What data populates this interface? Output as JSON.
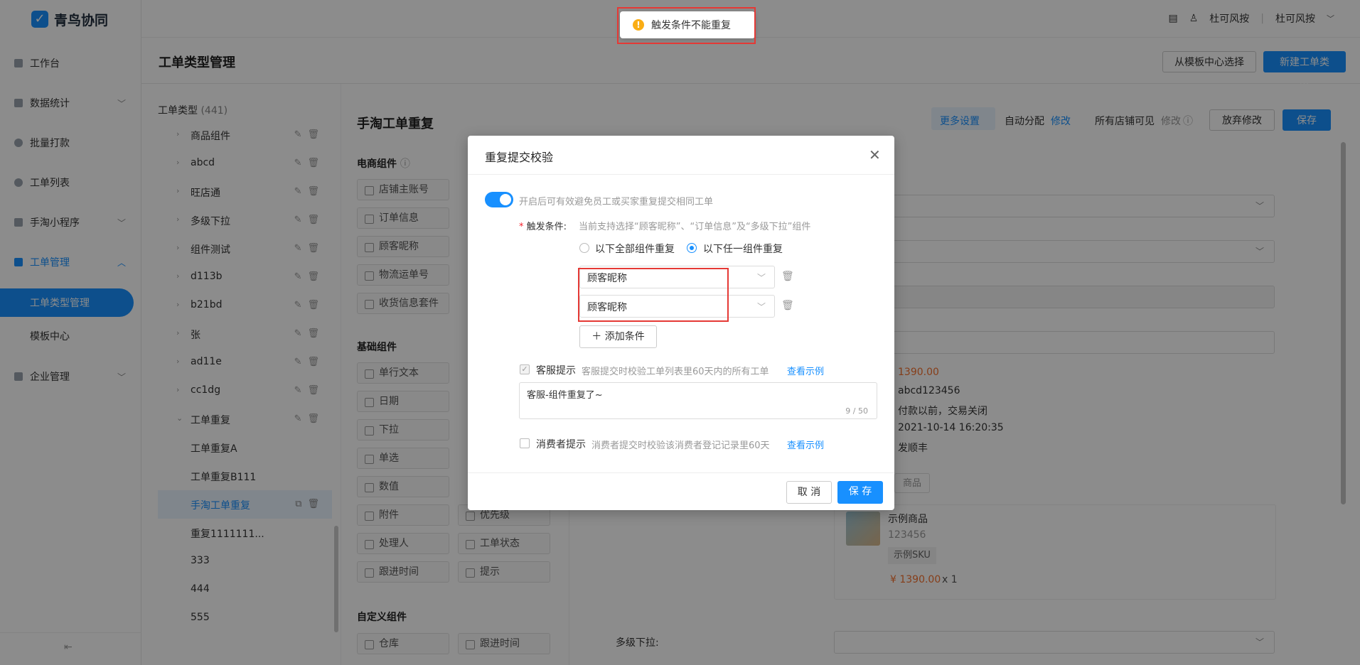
{
  "brand": "青鸟协同",
  "header": {
    "user_left": "杜可风按",
    "user_right": "杜可风按"
  },
  "sidebar": {
    "items": [
      {
        "label": "工作台",
        "expandable": false
      },
      {
        "label": "数据统计",
        "expandable": true
      },
      {
        "label": "批量打款",
        "expandable": false
      },
      {
        "label": "工单列表",
        "expandable": false
      },
      {
        "label": "手淘小程序",
        "expandable": true
      },
      {
        "label": "工单管理",
        "expandable": true,
        "open": true
      },
      {
        "label": "企业管理",
        "expandable": true
      }
    ],
    "subitems": [
      "工单类型管理",
      "模板中心"
    ]
  },
  "page": {
    "title": "工单类型管理",
    "btn_template": "从模板中心选择",
    "btn_new": "新建工单类型"
  },
  "tree": {
    "head": "工单类型",
    "count": "(441)",
    "rows": [
      "商品组件",
      "abcd",
      "旺店通",
      "多级下拉",
      "组件测试",
      "d113b",
      "b21bd",
      "张",
      "ad11e",
      "cc1dg",
      "工单重复"
    ],
    "children": [
      "工单重复A",
      "工单重复B111",
      "手淘工单重复",
      "重复1111111...",
      "333",
      "444",
      "555"
    ],
    "selected": "手淘工单重复"
  },
  "editor": {
    "title": "手淘工单重复",
    "more_settings": "更多设置",
    "auto_assign": "自动分配",
    "modify": "修改",
    "all_visible": "所有店铺可见",
    "modify2": "修改",
    "discard": "放弃修改",
    "save": "保存",
    "section_ecom": "电商组件",
    "ecom": [
      "店铺主账号",
      "订单信息",
      "顾客昵称",
      "物流运单号",
      "收货信息套件"
    ],
    "section_basic": "基础组件",
    "basic_left": [
      "单行文本",
      "日期",
      "下拉",
      "单选",
      "数值",
      "附件",
      "处理人",
      "跟进时间"
    ],
    "basic_right": [
      "优先级",
      "工单状态",
      "提示"
    ],
    "section_custom": "自定义组件",
    "custom": [
      "仓库",
      "跟进时间"
    ],
    "info": {
      "price": "1390.00",
      "order_no": "abcd123456",
      "status": "付款以前，交易关闭",
      "time": "2021-10-14 16:20:35",
      "logistics": "发顺丰"
    },
    "product": {
      "tag": "商品",
      "name": "示例商品",
      "id": "123456",
      "sku": "示例SKU",
      "price": "¥ 1390.00",
      "qty": "x 1"
    },
    "multi_dropdown": "多级下拉:"
  },
  "toast": {
    "text": "触发条件不能重复"
  },
  "dialog": {
    "title": "重复提交校验",
    "toggle_desc": "开启后可有效避免员工或买家重复提交相同工单",
    "trigger_label": "触发条件:",
    "trigger_hint": "当前支持选择“顾客昵称”、“订单信息”及“多级下拉”组件",
    "radio_all": "以下全部组件重复",
    "radio_any": "以下任一组件重复",
    "cond1": "顾客昵称",
    "cond2": "顾客昵称",
    "add": "添加条件",
    "cs_label": "客服提示",
    "cs_desc": "客服提交时校验工单列表里60天内的所有工单",
    "example1": "查看示例",
    "cs_text": "客服-组件重复了~",
    "cs_count": "9 / 50",
    "cons_label": "消费者提示",
    "cons_desc": "消费者提交时校验该消费者登记记录里60天",
    "example2": "查看示例",
    "cancel": "取 消",
    "save": "保 存"
  }
}
